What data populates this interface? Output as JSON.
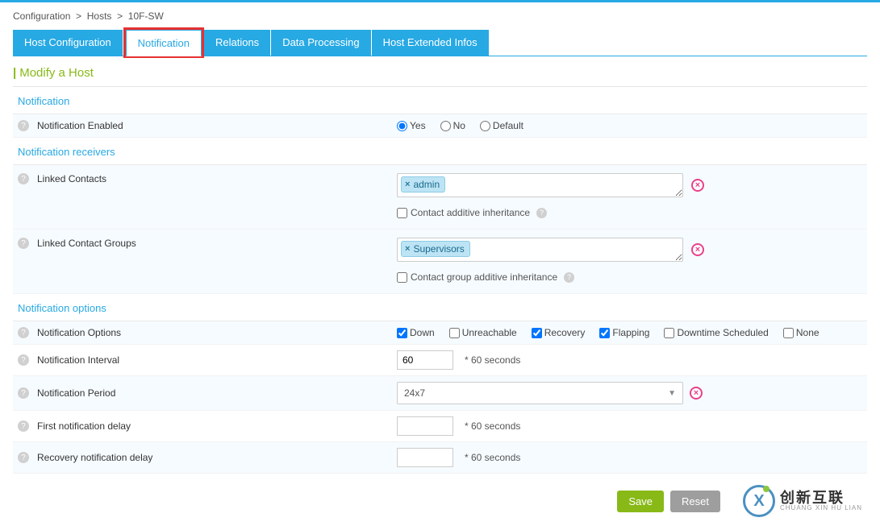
{
  "breadcrumb": {
    "l1": "Configuration",
    "l2": "Hosts",
    "l3": "10F-SW"
  },
  "tabs": {
    "host_config": "Host Configuration",
    "notification": "Notification",
    "relations": "Relations",
    "data_processing": "Data Processing",
    "extended": "Host Extended Infos"
  },
  "page_title": "Modify a Host",
  "sections": {
    "notification": "Notification",
    "receivers": "Notification receivers",
    "options": "Notification options"
  },
  "labels": {
    "notif_enabled": "Notification Enabled",
    "linked_contacts": "Linked Contacts",
    "linked_groups": "Linked Contact Groups",
    "contact_inherit": "Contact additive inheritance",
    "group_inherit": "Contact group additive inheritance",
    "notif_options": "Notification Options",
    "notif_interval": "Notification Interval",
    "notif_period": "Notification Period",
    "first_delay": "First notification delay",
    "recovery_delay": "Recovery notification delay"
  },
  "radios": {
    "yes": "Yes",
    "no": "No",
    "default": "Default"
  },
  "tags": {
    "admin": "admin",
    "supervisors": "Supervisors"
  },
  "checks": {
    "down": "Down",
    "unreachable": "Unreachable",
    "recovery": "Recovery",
    "flapping": "Flapping",
    "downtime": "Downtime Scheduled",
    "none": "None"
  },
  "values": {
    "interval": "60",
    "period": "24x7",
    "first_delay": "",
    "recovery_delay": ""
  },
  "suffix_seconds": "* 60 seconds",
  "buttons": {
    "save": "Save",
    "reset": "Reset"
  },
  "logo": {
    "cn": "创新互联",
    "en": "CHUANG XIN HU LIAN"
  }
}
